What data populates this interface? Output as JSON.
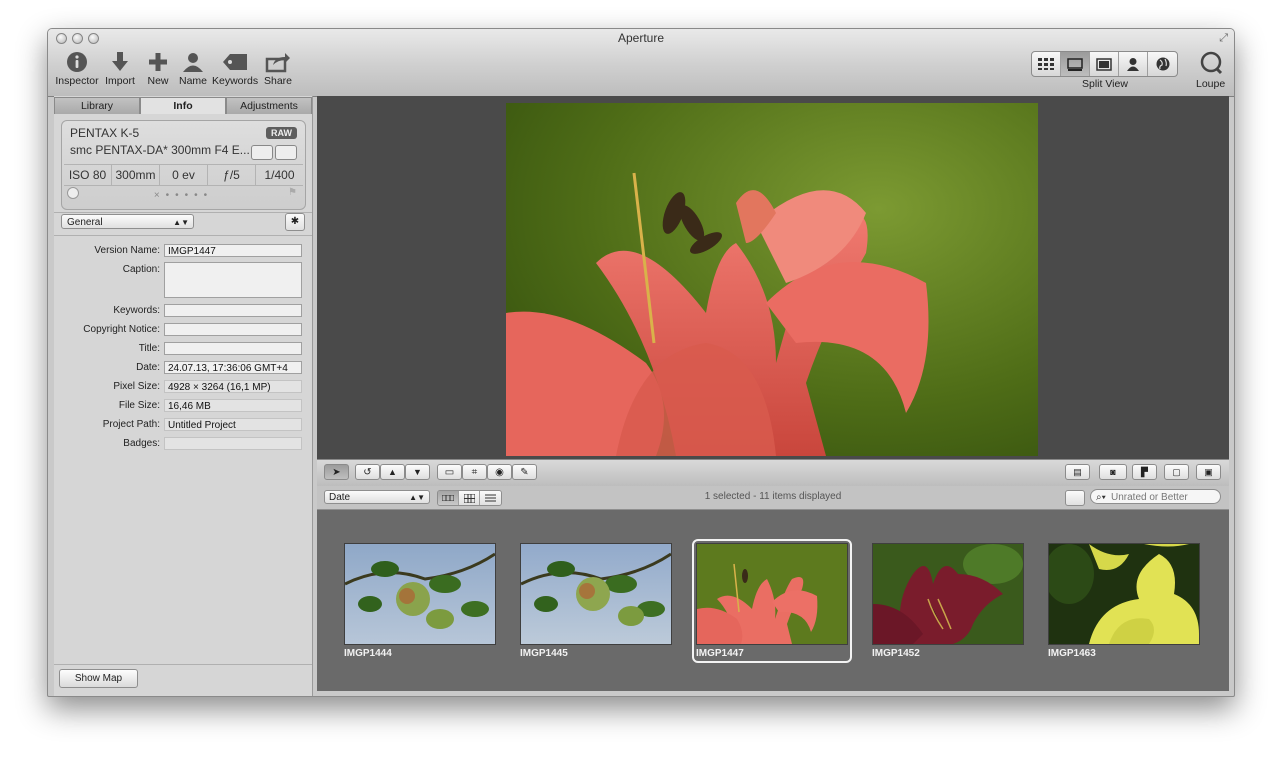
{
  "window": {
    "title": "Aperture"
  },
  "toolbar": {
    "inspector": "Inspector",
    "import": "Import",
    "new": "New",
    "name": "Name",
    "keywords": "Keywords",
    "share": "Share",
    "split_view": "Split View",
    "loupe": "Loupe"
  },
  "inspector_tabs": [
    "Library",
    "Info",
    "Adjustments"
  ],
  "hud": {
    "camera": "PENTAX K-5",
    "lens": "smc PENTAX-DA* 300mm F4 E...",
    "format_badge": "RAW",
    "exif": [
      "ISO 80",
      "300mm",
      "0 ev",
      "ƒ/5",
      "1/400"
    ]
  },
  "metadata_view": "General",
  "fields": {
    "version_name": {
      "label": "Version Name:",
      "value": "IMGP1447"
    },
    "caption": {
      "label": "Caption:",
      "value": ""
    },
    "keywords": {
      "label": "Keywords:",
      "value": ""
    },
    "copyright": {
      "label": "Copyright Notice:",
      "value": ""
    },
    "title": {
      "label": "Title:",
      "value": ""
    },
    "date": {
      "label": "Date:",
      "value": "24.07.13, 17:36:06 GMT+4"
    },
    "pixel_size": {
      "label": "Pixel Size:",
      "value": "4928 × 3264 (16,1 MP)"
    },
    "file_size": {
      "label": "File Size:",
      "value": "16,46 MB"
    },
    "project_path": {
      "label": "Project Path:",
      "value": "Untitled Project"
    },
    "badges": {
      "label": "Badges:",
      "value": ""
    }
  },
  "show_map": "Show Map",
  "browser": {
    "sort": "Date",
    "status": "1 selected - 11 items displayed",
    "search_placeholder": "Unrated or Better",
    "thumbnails": [
      {
        "name": "IMGP1444",
        "selected": false
      },
      {
        "name": "IMGP1445",
        "selected": false
      },
      {
        "name": "IMGP1447",
        "selected": true
      },
      {
        "name": "IMGP1452",
        "selected": false
      },
      {
        "name": "IMGP1463",
        "selected": false
      }
    ]
  },
  "colors": {
    "viewer_bg": "#4a4a4a",
    "browser_bg": "#6a6a6a",
    "selection": "#f3f3f3"
  }
}
